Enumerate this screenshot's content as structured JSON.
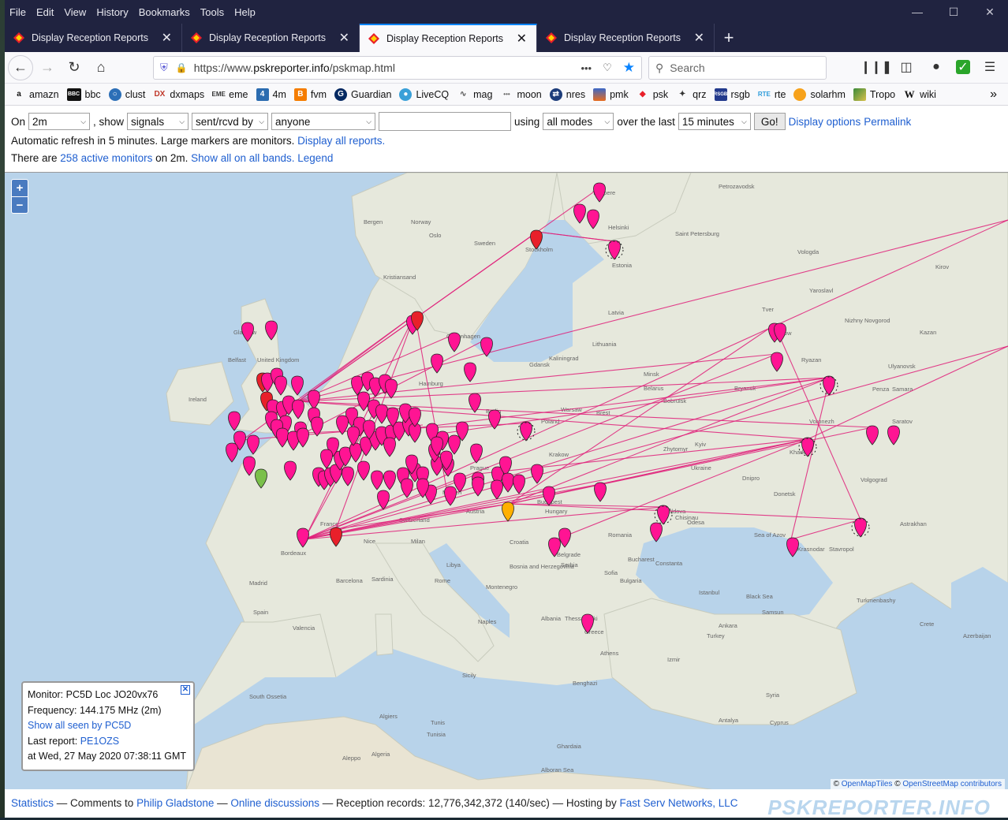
{
  "menu": [
    "File",
    "Edit",
    "View",
    "History",
    "Bookmarks",
    "Tools",
    "Help"
  ],
  "tabs": [
    {
      "label": "Display Reception Reports",
      "active": false
    },
    {
      "label": "Display Reception Reports",
      "active": false
    },
    {
      "label": "Display Reception Reports",
      "active": true
    },
    {
      "label": "Display Reception Reports",
      "active": false
    }
  ],
  "url": {
    "prefix": "https://www.",
    "domain": "pskreporter.info",
    "path": "/pskmap.html"
  },
  "search": {
    "placeholder": "Search"
  },
  "bookmarks": [
    {
      "label": "amazn",
      "icon": "amazon-icon"
    },
    {
      "label": "bbc",
      "icon": "bbc-icon"
    },
    {
      "label": "clust",
      "icon": "globe-icon"
    },
    {
      "label": "dxmaps",
      "icon": "dxmaps-icon"
    },
    {
      "label": "eme",
      "icon": "eme-icon"
    },
    {
      "label": "4m",
      "icon": "number4-icon"
    },
    {
      "label": "fvm",
      "icon": "blogger-icon"
    },
    {
      "label": "Guardian",
      "icon": "guardian-icon"
    },
    {
      "label": "LiveCQ",
      "icon": "livecq-icon"
    },
    {
      "label": "mag",
      "icon": "mag-icon"
    },
    {
      "label": "moon",
      "icon": "moon-icon"
    },
    {
      "label": "nres",
      "icon": "nres-icon"
    },
    {
      "label": "pmk",
      "icon": "pmk-icon"
    },
    {
      "label": "psk",
      "icon": "psk-icon"
    },
    {
      "label": "qrz",
      "icon": "qrz-icon"
    },
    {
      "label": "rsgb",
      "icon": "rsgb-icon"
    },
    {
      "label": "rte",
      "icon": "rte-icon"
    },
    {
      "label": "solarhm",
      "icon": "solar-icon"
    },
    {
      "label": "Tropo",
      "icon": "tropo-icon"
    },
    {
      "label": "wiki",
      "icon": "wikipedia-icon"
    }
  ],
  "controls": {
    "on_label": "On",
    "band": "2m",
    "show_label": ", show",
    "signals": "signals",
    "sentrcvd": "sent/rcvd by",
    "anyone": "anyone",
    "callsign_value": "",
    "using_label": "using",
    "mode": "all modes",
    "over_label": "over the last",
    "period": "15 minutes",
    "go": "Go!",
    "display_options": "Display options",
    "permalink": "Permalink",
    "refresh_text": "Automatic refresh in 5 minutes. Large markers are monitors.",
    "display_all": "Display all reports.",
    "there_are": "There are",
    "active_monitors": "258 active monitors",
    "on_band": "on 2m.",
    "show_all": "Show all on all bands.",
    "legend": "Legend"
  },
  "map_labels": [
    "Petrozavodsk",
    "Tampere",
    "Helsinki",
    "Saint Petersburg",
    "Stockholm",
    "Bergen",
    "Norway",
    "Oslo",
    "Sweden",
    "Estonia",
    "Latvia",
    "Kristiansand",
    "Copenhagen",
    "Lithuania",
    "Vologda",
    "Kirov",
    "Yaroslavl",
    "Tver",
    "Moscow",
    "Nizhny Novgorod",
    "Kazan",
    "Ryazan",
    "Ulyanovsk",
    "Samara",
    "Penza",
    "Saratov",
    "Voronezh",
    "Volgograd",
    "Bryansk",
    "Belarus",
    "Minsk",
    "Bobruisk",
    "Brest",
    "Warsaw",
    "Poland",
    "Kaliningrad",
    "Gdansk",
    "Hamburg",
    "Berlin",
    "Prague",
    "Krakow",
    "Zhytomyr",
    "Kyiv",
    "Ukraine",
    "Kharkiv",
    "Dnipro",
    "Donetsk",
    "Odesa",
    "Moldova",
    "Chisinau",
    "Romania",
    "Bucharest",
    "Constanta",
    "Hungary",
    "Budapest",
    "Austria",
    "Munich",
    "Switzerland",
    "France",
    "Milan",
    "Nice",
    "Croatia",
    "Bosnia and Herzegovina",
    "Belgrade",
    "Serbia",
    "Sofia",
    "Bulgaria",
    "Istanbul",
    "Greece",
    "Athens",
    "Thessaloniki",
    "Albania",
    "Montenegro",
    "Naples",
    "Rome",
    "Sardinia",
    "Sicily",
    "Tunisia",
    "Tunis",
    "Algeria",
    "Algiers",
    "Spain",
    "Madrid",
    "Barcelona",
    "Valencia",
    "Bordeaux",
    "Ireland",
    "Belfast",
    "Glasgow",
    "United Kingdom",
    "Sea of Azov",
    "Krasnodar",
    "Stavropol",
    "Astrakhan",
    "Black Sea",
    "Samsun",
    "Ankara",
    "Turkey",
    "Izmir",
    "Antalya",
    "Cyprus",
    "Syria",
    "Aleppo",
    "Ghardaia",
    "Benghazi",
    "Crete",
    "Azerbaijan",
    "Turkmenbashy",
    "South Ossetia",
    "Alboran Sea",
    "Libya",
    "Tarvisio"
  ],
  "popup": {
    "monitor": "Monitor: PC5D Loc JO20vx76",
    "frequency": "Frequency: 144.175 MHz (2m)",
    "show_all_seen": "Show all seen by PC5D",
    "last_report_label": "Last report:",
    "last_report_call": "PE1OZS",
    "timestamp": "at Wed, 27 May 2020 07:38:11 GMT"
  },
  "attribution": {
    "prefix": "©",
    "openmaptiles": "OpenMapTiles",
    "osm": "OpenStreetMap contributors"
  },
  "footer": {
    "statistics": "Statistics",
    "comments_to": "— Comments to",
    "author": "Philip Gladstone",
    "sep1": "—",
    "discussions": "Online discussions",
    "records": "— Reception records: 12,776,342,372 (140/sec) — Hosting by",
    "host": "Fast Serv Networks, LLC",
    "brand": "PSKREPORTER.INFO"
  },
  "colors": {
    "marker": "#ff1493",
    "marker_red": "#e8202a",
    "path": "#e0207a",
    "accent": "#0a84ff",
    "link": "#1f5fd0"
  }
}
